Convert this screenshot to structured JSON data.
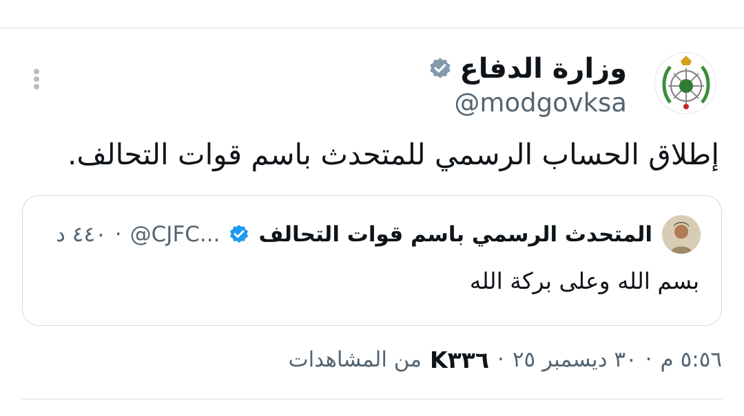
{
  "tweet": {
    "author": {
      "display_name": "وزارة الدفاع",
      "handle": "@modgovksa",
      "verified": true,
      "avatar_icon": "ministry-of-defense-emblem"
    },
    "text": "إطلاق الحساب الرسمي للمتحدث باسم قوات التحالف.",
    "more_icon": "vertical-ellipsis-icon",
    "quote": {
      "display_name": "المتحدث الرسمي باسم قوات التحالف",
      "handle": "@CJFC...",
      "separator": "·",
      "time": "٤٤٠ د",
      "verified": true,
      "text": "بسم الله وعلى بركة الله"
    },
    "meta": {
      "time": "٥:٥٦ م",
      "date": "٣٠ ديسمبر ٢٥",
      "separator": "·",
      "views_count": "K٣٣٦",
      "views_label": "من المشاهدات"
    }
  },
  "colors": {
    "text_primary": "#0f1419",
    "text_secondary": "#536471",
    "verified_gray": "#829aab",
    "verified_blue": "#1d9bf0",
    "divider": "#d9dde1"
  }
}
